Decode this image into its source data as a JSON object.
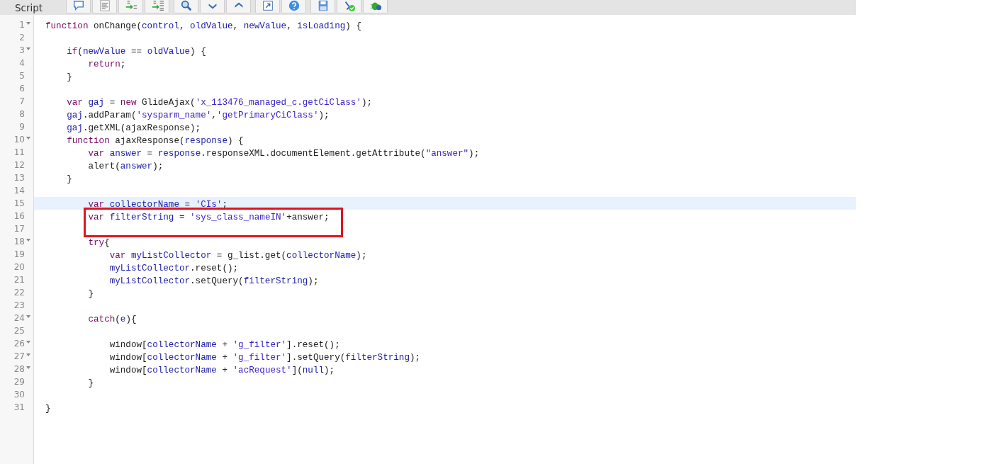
{
  "header": {
    "title": "Script"
  },
  "lines": [
    {
      "number": "1",
      "fold": true,
      "selected": false,
      "boxed": false,
      "tokens": [
        {
          "kind": "keyword",
          "text": "function"
        },
        {
          "kind": "plain",
          "text": " onChange("
        },
        {
          "kind": "variable",
          "text": "control"
        },
        {
          "kind": "plain",
          "text": ", "
        },
        {
          "kind": "variable",
          "text": "oldValue"
        },
        {
          "kind": "plain",
          "text": ", "
        },
        {
          "kind": "variable",
          "text": "newValue"
        },
        {
          "kind": "plain",
          "text": ", "
        },
        {
          "kind": "variable",
          "text": "isLoading"
        },
        {
          "kind": "plain",
          "text": ") {"
        }
      ]
    },
    {
      "number": "2",
      "fold": false,
      "selected": false,
      "boxed": false
    },
    {
      "number": "3",
      "fold": true,
      "selected": false,
      "boxed": false,
      "tokens": [
        {
          "kind": "keyword",
          "text": "    if"
        },
        {
          "kind": "plain",
          "text": "("
        },
        {
          "kind": "variable",
          "text": "newValue"
        },
        {
          "kind": "plain",
          "text": " == "
        },
        {
          "kind": "variable",
          "text": "oldValue"
        },
        {
          "kind": "plain",
          "text": ") {"
        }
      ]
    },
    {
      "number": "4",
      "fold": false,
      "selected": false,
      "boxed": false,
      "tokens": [
        {
          "kind": "keyword",
          "text": "        return"
        },
        {
          "kind": "plain",
          "text": ";"
        }
      ]
    },
    {
      "number": "5",
      "fold": false,
      "selected": false,
      "boxed": false,
      "tokens": [
        {
          "kind": "plain",
          "text": "    }"
        }
      ]
    },
    {
      "number": "6",
      "fold": false,
      "selected": false,
      "boxed": false
    },
    {
      "number": "7",
      "fold": false,
      "selected": false,
      "boxed": false,
      "tokens": [
        {
          "kind": "keyword",
          "text": "    var"
        },
        {
          "kind": "variable",
          "text": " gaj"
        },
        {
          "kind": "plain",
          "text": " = "
        },
        {
          "kind": "keyword",
          "text": "new"
        },
        {
          "kind": "plain",
          "text": " GlideAjax("
        },
        {
          "kind": "string",
          "text": "'x_113476_managed_c.getCiClass'"
        },
        {
          "kind": "plain",
          "text": ");"
        }
      ]
    },
    {
      "number": "8",
      "fold": false,
      "selected": false,
      "boxed": false,
      "tokens": [
        {
          "kind": "variable",
          "text": "    gaj"
        },
        {
          "kind": "plain",
          "text": ".addParam("
        },
        {
          "kind": "string",
          "text": "'sysparm_name'"
        },
        {
          "kind": "plain",
          "text": ","
        },
        {
          "kind": "string",
          "text": "'getPrimaryCiClass'"
        },
        {
          "kind": "plain",
          "text": ");"
        }
      ]
    },
    {
      "number": "9",
      "fold": false,
      "selected": false,
      "boxed": false,
      "tokens": [
        {
          "kind": "variable",
          "text": "    gaj"
        },
        {
          "kind": "plain",
          "text": ".getXML(ajaxResponse);"
        }
      ]
    },
    {
      "number": "10",
      "fold": true,
      "selected": false,
      "boxed": false,
      "tokens": [
        {
          "kind": "keyword",
          "text": "    function"
        },
        {
          "kind": "plain",
          "text": " ajaxResponse("
        },
        {
          "kind": "variable",
          "text": "response"
        },
        {
          "kind": "plain",
          "text": ") {"
        }
      ]
    },
    {
      "number": "11",
      "fold": false,
      "selected": false,
      "boxed": false,
      "tokens": [
        {
          "kind": "keyword",
          "text": "        var"
        },
        {
          "kind": "variable",
          "text": " answer"
        },
        {
          "kind": "plain",
          "text": " = "
        },
        {
          "kind": "variable",
          "text": "response"
        },
        {
          "kind": "plain",
          "text": ".responseXML.documentElement.getAttribute("
        },
        {
          "kind": "string",
          "text": "\"answer\""
        },
        {
          "kind": "plain",
          "text": ");"
        }
      ]
    },
    {
      "number": "12",
      "fold": false,
      "selected": false,
      "boxed": false,
      "tokens": [
        {
          "kind": "plain",
          "text": "        alert("
        },
        {
          "kind": "variable",
          "text": "answer"
        },
        {
          "kind": "plain",
          "text": ");"
        }
      ]
    },
    {
      "number": "13",
      "fold": false,
      "selected": false,
      "boxed": false,
      "tokens": [
        {
          "kind": "plain",
          "text": "    }"
        }
      ]
    },
    {
      "number": "14",
      "fold": false,
      "selected": false,
      "boxed": false
    },
    {
      "number": "15",
      "fold": false,
      "selected": true,
      "boxed": false,
      "tokens": [
        {
          "kind": "keyword",
          "text": "        var"
        },
        {
          "kind": "variable",
          "text": " collectorName"
        },
        {
          "kind": "plain",
          "text": " = "
        },
        {
          "kind": "string",
          "text": "'CIs'"
        },
        {
          "kind": "plain",
          "text": ";"
        }
      ]
    },
    {
      "number": "16",
      "fold": false,
      "selected": false,
      "boxed": true,
      "tokens": [
        {
          "kind": "keyword",
          "text": "        var"
        },
        {
          "kind": "variable",
          "text": " filterString"
        },
        {
          "kind": "plain",
          "text": " = "
        },
        {
          "kind": "string",
          "text": "'sys_class_nameIN'"
        },
        {
          "kind": "plain",
          "text": "+answer;"
        }
      ]
    },
    {
      "number": "17",
      "fold": false,
      "selected": false,
      "boxed": true
    },
    {
      "number": "18",
      "fold": true,
      "selected": false,
      "boxed": false,
      "tokens": [
        {
          "kind": "keyword",
          "text": "        try"
        },
        {
          "kind": "plain",
          "text": "{"
        }
      ]
    },
    {
      "number": "19",
      "fold": false,
      "selected": false,
      "boxed": false,
      "tokens": [
        {
          "kind": "keyword",
          "text": "            var"
        },
        {
          "kind": "variable",
          "text": " myListCollector"
        },
        {
          "kind": "plain",
          "text": " = g_list.get("
        },
        {
          "kind": "variable",
          "text": "collectorName"
        },
        {
          "kind": "plain",
          "text": ");"
        }
      ]
    },
    {
      "number": "20",
      "fold": false,
      "selected": false,
      "boxed": false,
      "tokens": [
        {
          "kind": "variable",
          "text": "            myListCollector"
        },
        {
          "kind": "plain",
          "text": ".reset();"
        }
      ]
    },
    {
      "number": "21",
      "fold": false,
      "selected": false,
      "boxed": false,
      "tokens": [
        {
          "kind": "variable",
          "text": "            myListCollector"
        },
        {
          "kind": "plain",
          "text": ".setQuery("
        },
        {
          "kind": "variable",
          "text": "filterString"
        },
        {
          "kind": "plain",
          "text": ");"
        }
      ]
    },
    {
      "number": "22",
      "fold": false,
      "selected": false,
      "boxed": false,
      "tokens": [
        {
          "kind": "plain",
          "text": "        }"
        }
      ]
    },
    {
      "number": "23",
      "fold": false,
      "selected": false,
      "boxed": false
    },
    {
      "number": "24",
      "fold": true,
      "selected": false,
      "boxed": false,
      "tokens": [
        {
          "kind": "keyword",
          "text": "        catch"
        },
        {
          "kind": "plain",
          "text": "("
        },
        {
          "kind": "variable",
          "text": "e"
        },
        {
          "kind": "plain",
          "text": "){"
        }
      ]
    },
    {
      "number": "25",
      "fold": false,
      "selected": false,
      "boxed": false
    },
    {
      "number": "26",
      "fold": true,
      "selected": false,
      "boxed": false,
      "tokens": [
        {
          "kind": "plain",
          "text": "            window["
        },
        {
          "kind": "variable",
          "text": "collectorName"
        },
        {
          "kind": "plain",
          "text": " + "
        },
        {
          "kind": "string",
          "text": "'g_filter'"
        },
        {
          "kind": "plain",
          "text": "].reset();"
        }
      ]
    },
    {
      "number": "27",
      "fold": true,
      "selected": false,
      "boxed": false,
      "tokens": [
        {
          "kind": "plain",
          "text": "            window["
        },
        {
          "kind": "variable",
          "text": "collectorName"
        },
        {
          "kind": "plain",
          "text": " + "
        },
        {
          "kind": "string",
          "text": "'g_filter'"
        },
        {
          "kind": "plain",
          "text": "].setQuery("
        },
        {
          "kind": "variable",
          "text": "filterString"
        },
        {
          "kind": "plain",
          "text": ");"
        }
      ]
    },
    {
      "number": "28",
      "fold": true,
      "selected": false,
      "boxed": false,
      "tokens": [
        {
          "kind": "plain",
          "text": "            window["
        },
        {
          "kind": "variable",
          "text": "collectorName"
        },
        {
          "kind": "plain",
          "text": " + "
        },
        {
          "kind": "string",
          "text": "'acRequest'"
        },
        {
          "kind": "plain",
          "text": "]("
        },
        {
          "kind": "variable",
          "text": "null"
        },
        {
          "kind": "plain",
          "text": ");"
        }
      ]
    },
    {
      "number": "29",
      "fold": false,
      "selected": false,
      "boxed": false,
      "tokens": [
        {
          "kind": "plain",
          "text": "        }"
        }
      ]
    },
    {
      "number": "30",
      "fold": false,
      "selected": false,
      "boxed": false
    },
    {
      "number": "31",
      "fold": false,
      "selected": false,
      "boxed": false,
      "tokens": [
        {
          "kind": "plain",
          "text": "}"
        }
      ]
    }
  ]
}
